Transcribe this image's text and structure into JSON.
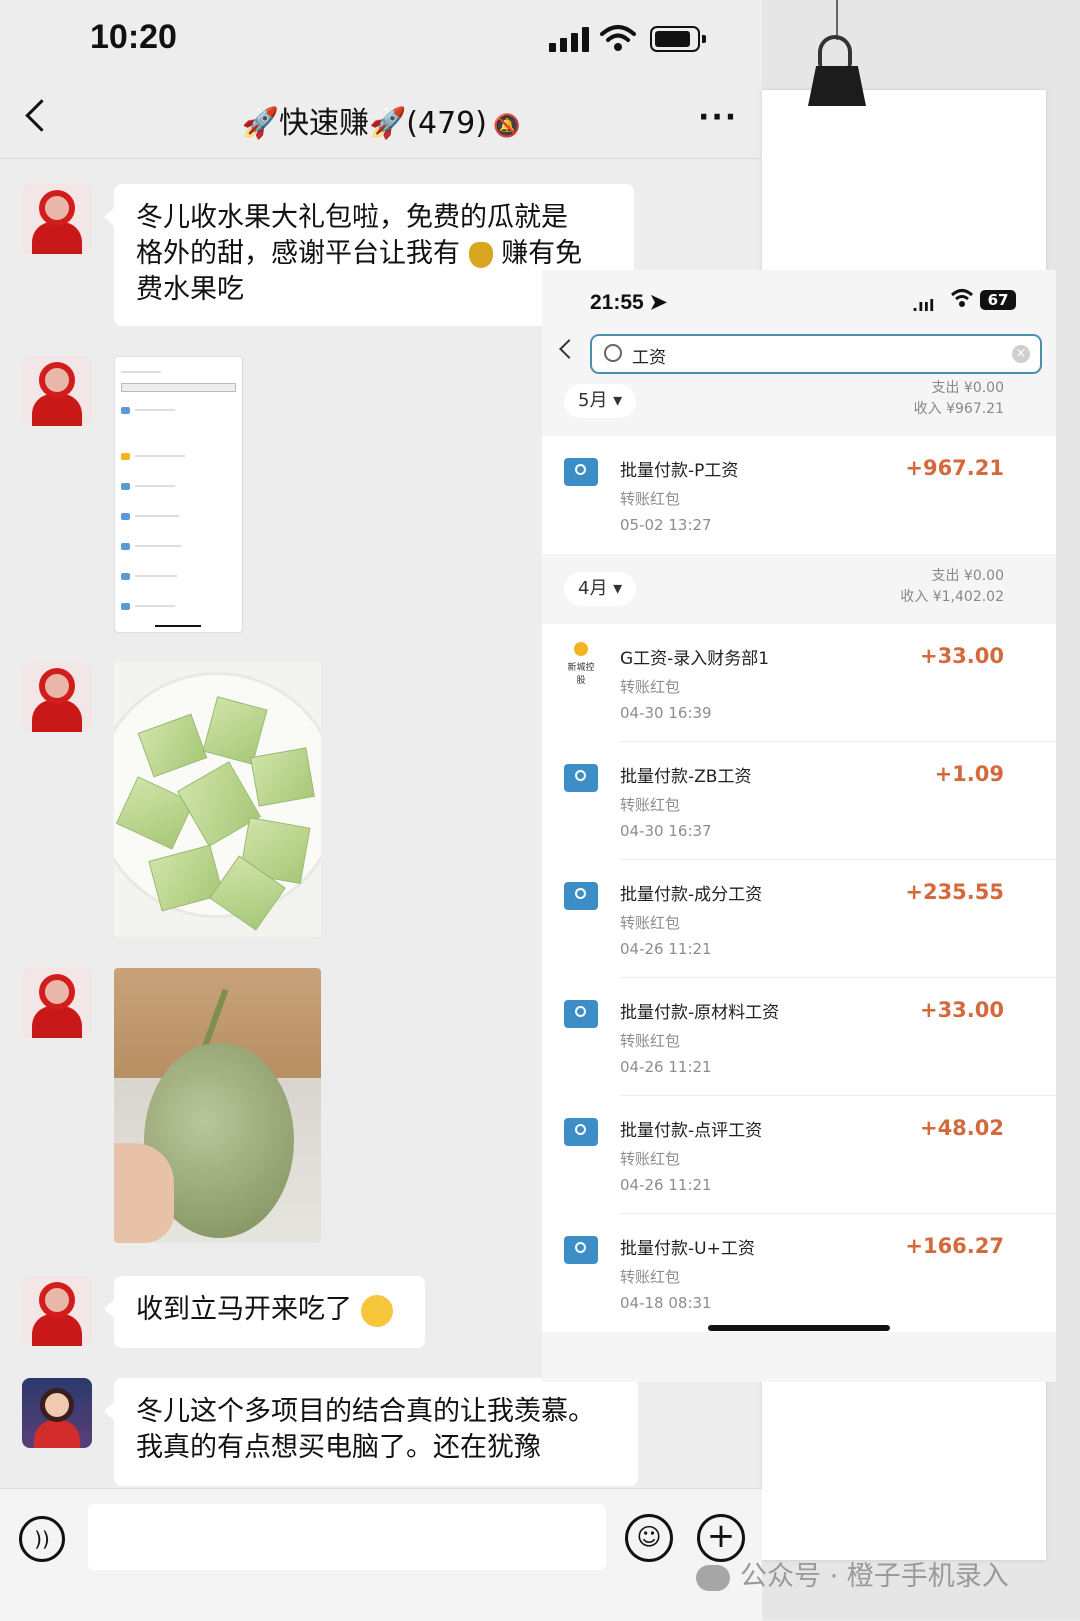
{
  "status_bar": {
    "time": "10:20"
  },
  "chat": {
    "title": "🚀快速赚🚀(479)",
    "mute_icon": "🔕"
  },
  "messages": {
    "m1": {
      "line1": "冬儿收水果大礼包啦，免费的瓜就是",
      "line2a": "格外的甜，感谢平台让我有",
      "line2b": "赚有免",
      "line3": "费水果吃"
    },
    "m5": {
      "text": "收到立马开来吃了"
    },
    "m6": {
      "line1": "冬儿这个多项目的结合真的让我羡慕。",
      "line2": "我真的有点想买电脑了。还在犹豫"
    }
  },
  "overlay": {
    "status_time": "21:55",
    "battery": "67",
    "search_query": "工资",
    "may": {
      "month": "5月",
      "expense": "支出 ¥0.00",
      "income": "收入 ¥967.21"
    },
    "april": {
      "month": "4月",
      "expense": "支出 ¥0.00",
      "income": "收入 ¥1,402.02"
    },
    "transactions": [
      {
        "name": "批量付款-P工资",
        "sub": "转账红包",
        "date": "05-02 13:27",
        "amount": "+967.21"
      },
      {
        "name": "G工资-录入财务部1",
        "sub": "转账红包",
        "date": "04-30 16:39",
        "amount": "+33.00",
        "logo_text": "新城控股"
      },
      {
        "name": "批量付款-ZB工资",
        "sub": "转账红包",
        "date": "04-30 16:37",
        "amount": "+1.09"
      },
      {
        "name": "批量付款-成分工资",
        "sub": "转账红包",
        "date": "04-26 11:21",
        "amount": "+235.55"
      },
      {
        "name": "批量付款-原材料工资",
        "sub": "转账红包",
        "date": "04-26 11:21",
        "amount": "+33.00"
      },
      {
        "name": "批量付款-点评工资",
        "sub": "转账红包",
        "date": "04-26 11:21",
        "amount": "+48.02"
      },
      {
        "name": "批量付款-U+工资",
        "sub": "转账红包",
        "date": "04-18 08:31",
        "amount": "+166.27"
      }
    ]
  },
  "watermark": {
    "text": "公众号 · 橙子手机录入"
  }
}
